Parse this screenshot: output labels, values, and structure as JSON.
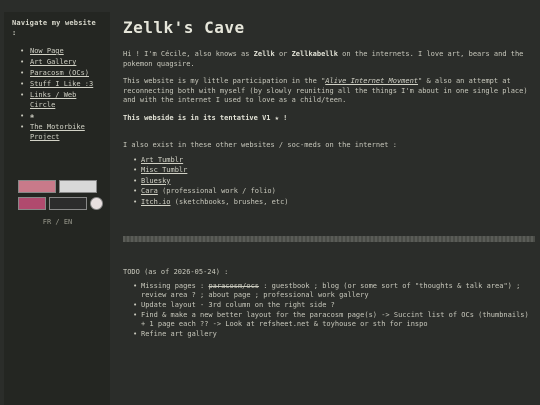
{
  "sidebar": {
    "title": "Navigate my website :",
    "items": [
      {
        "label": "Now Page"
      },
      {
        "label": "Art Gallery"
      },
      {
        "label": "Paracosm (OCs)"
      },
      {
        "label": "Stuff I Like :3"
      },
      {
        "label": "Links / Web Circle"
      },
      {
        "label": "❀"
      },
      {
        "label": "The Motorbike Project"
      }
    ],
    "badges": [
      "pink-button-badge",
      "white-button-badge",
      "magenta-button-badge",
      "dark-button-badge",
      "circle-badge"
    ],
    "lang_fr": "FR",
    "lang_sep": " / ",
    "lang_en": "EN"
  },
  "main": {
    "title": "Zellk's Cave",
    "intro_a": "Hi ! I'm Cécile, also knows as ",
    "intro_name1": "Zellk",
    "intro_b": " or ",
    "intro_name2": "Zellkabellk",
    "intro_c": " on the internets. I love art, bears and the pokemon quagsire.",
    "p2_a": "This website is my little participation in the \"",
    "p2_link": "Alive Internet Movment",
    "p2_b": "\" & also an attempt at reconnecting both with myself (by slowly reuniting all the things I'm about in one single place) and with the internet I used to love as a child/teen.",
    "tentative": "This webside is in its tentative V1 ★ !",
    "elsewhere": "I also exist in these other websites / soc-meds on the internet :",
    "links": [
      {
        "label": "Art Tumblr",
        "note": ""
      },
      {
        "label": "Misc Tumblr",
        "note": ""
      },
      {
        "label": "Bluesky",
        "note": ""
      },
      {
        "label": "Cara",
        "note": " (professional work / folio)"
      },
      {
        "label": "Itch.io",
        "note": " (sketchbooks, brushes, etc)"
      }
    ],
    "todo_title": "TODO (as of 2026-05-24) :",
    "todo": {
      "t1_a": "Missing pages : ",
      "t1_strike": "paracosm/ocs",
      "t1_b": " : guestbook ; blog (or some sort of \"thoughts & talk area\") ; review area ? ; about page ; professional work gallery",
      "t2": "Update layout - 3rd column on the right side ?",
      "t3": "Find & make a new better layout for the paracosm page(s) -> Succint list of OCs (thumbnails) + 1 page each ?? -> Look at refsheet.net & toyhouse or sth for inspo",
      "t4": "Refine art gallery"
    }
  }
}
